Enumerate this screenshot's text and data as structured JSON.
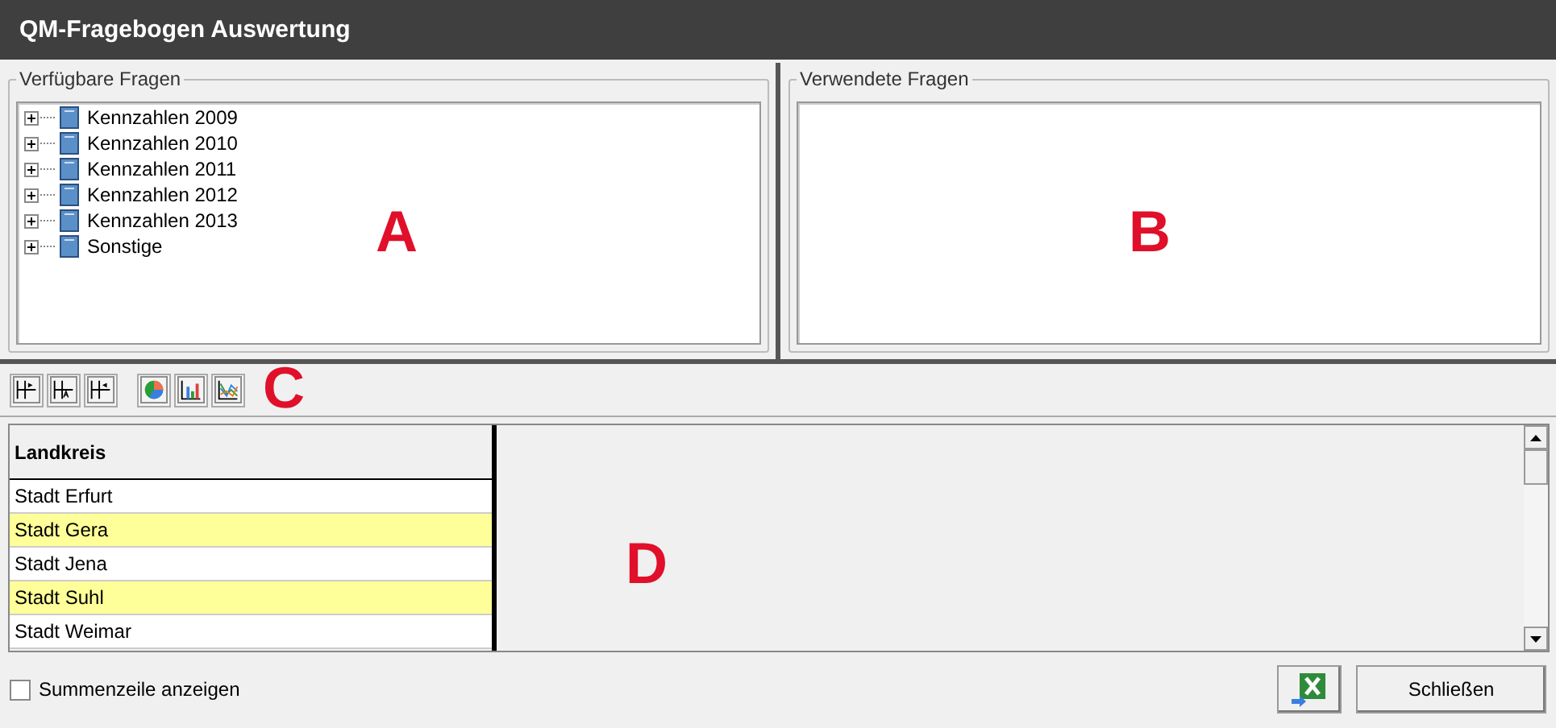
{
  "window": {
    "title": "QM-Fragebogen Auswertung"
  },
  "available": {
    "title": "Verfügbare Fragen",
    "tree": [
      {
        "label": "Kennzahlen 2009",
        "expanded": false
      },
      {
        "label": "Kennzahlen 2010",
        "expanded": false
      },
      {
        "label": "Kennzahlen 2011",
        "expanded": false
      },
      {
        "label": "Kennzahlen 2012",
        "expanded": false
      },
      {
        "label": "Kennzahlen 2013",
        "expanded": false
      },
      {
        "label": "Sonstige",
        "expanded": false
      }
    ],
    "marker": "A"
  },
  "used": {
    "title": "Verwendete Fragen",
    "marker": "B"
  },
  "toolbar": {
    "buttons": [
      {
        "kind": "col-left"
      },
      {
        "kind": "col-text"
      },
      {
        "kind": "col-right"
      },
      {
        "kind": "pie"
      },
      {
        "kind": "bar"
      },
      {
        "kind": "line"
      }
    ],
    "marker": "C"
  },
  "grid": {
    "column": "Landkreis",
    "rows": [
      {
        "label": "Stadt Erfurt",
        "highlighted": false
      },
      {
        "label": "Stadt Gera",
        "highlighted": true
      },
      {
        "label": "Stadt Jena",
        "highlighted": false
      },
      {
        "label": "Stadt Suhl",
        "highlighted": true
      },
      {
        "label": "Stadt Weimar",
        "highlighted": false
      }
    ],
    "marker": "D"
  },
  "footer": {
    "checkbox": {
      "label": "Summenzeile anzeigen",
      "checked": false
    },
    "close": "Schließen"
  }
}
